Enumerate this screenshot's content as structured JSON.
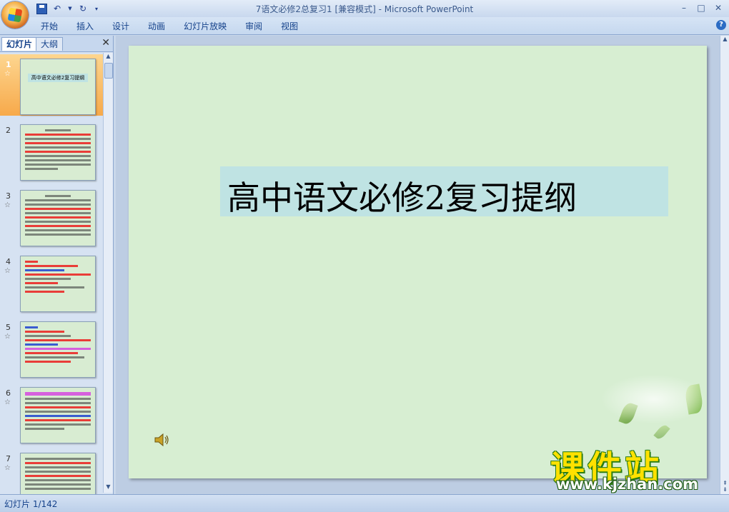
{
  "window": {
    "title": "7语文必修2总复习1 [兼容模式] - Microsoft PowerPoint",
    "controls": [
      "–",
      "□",
      "✕"
    ]
  },
  "ribbon": {
    "tabs": [
      "开始",
      "插入",
      "设计",
      "动画",
      "幻灯片放映",
      "审阅",
      "视图"
    ]
  },
  "left_pane": {
    "tabs": [
      "幻灯片",
      "大纲"
    ],
    "selected_tab": "幻灯片",
    "thumbnails": [
      {
        "number": "1",
        "selected": true,
        "title": "高中语文必修2复习提纲"
      },
      {
        "number": "2",
        "selected": false
      },
      {
        "number": "3",
        "selected": false
      },
      {
        "number": "4",
        "selected": false
      },
      {
        "number": "5",
        "selected": false
      },
      {
        "number": "6",
        "selected": false
      },
      {
        "number": "7",
        "selected": false
      }
    ]
  },
  "slide": {
    "title": "高中语文必修2复习提纲"
  },
  "watermark": {
    "big": "课件站",
    "url": "www.kjzhan.com"
  },
  "status": {
    "text": "幻灯片 1/142"
  },
  "colors": {
    "slide_bg": "#d7eed2",
    "title_box": "#bfe3e3",
    "selected_thumb": "#f7a94a",
    "watermark_yellow": "#ffe100"
  }
}
